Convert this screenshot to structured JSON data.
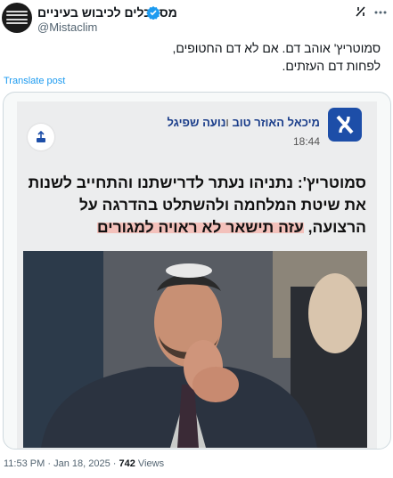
{
  "account": {
    "display_name": "מסתכלים לכיבוש בעיניים",
    "handle": "@Mistaclim",
    "avatar_text": "מסתכלים לכיבוש בעיניים"
  },
  "tweet": {
    "text_lines": [
      "סמוטריץ' אוהב דם. אם לא דם החטופים,",
      "לפחות דם העזתים."
    ],
    "translate_label": "Translate post"
  },
  "card": {
    "author_1": "מיכאל האוזר טוב",
    "author_sep": "ו",
    "author_2": "נועה שפיגל",
    "time": "18:44",
    "headline_part1": "סמוטריץ': נתניהו נעתר לדרישתנו והתחייב לשנות את שיטת המלחמה ולהשתלט בהדרגה על הרצועה,",
    "headline_highlight": "עזה תישאר לא ראויה למגורים"
  },
  "footer": {
    "time": "11:53 PM",
    "sep": "·",
    "date": "Jan 18, 2025",
    "views_count": "742",
    "views_label": "Views"
  },
  "colors": {
    "link": "#1d9bf0",
    "verified": "#1d9bf0",
    "highlight": "#f3c1bb",
    "site_logo": "#1d4ea8"
  }
}
